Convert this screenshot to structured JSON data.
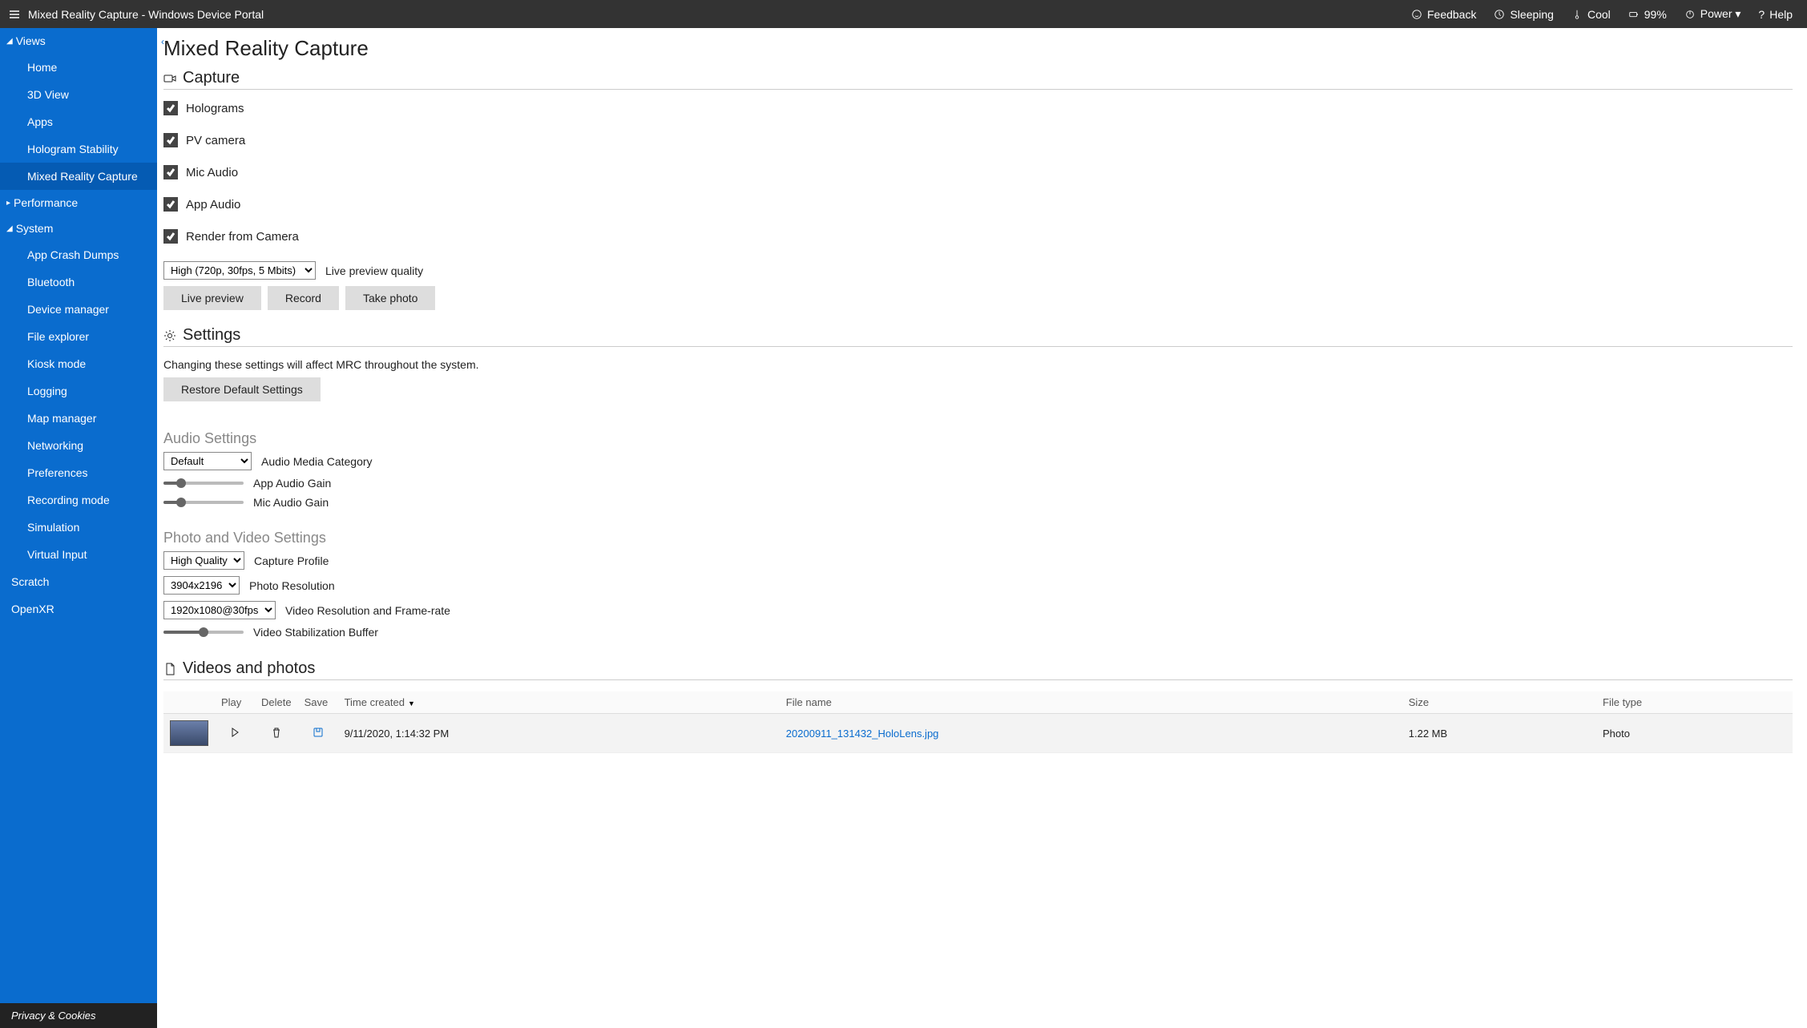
{
  "topbar": {
    "title": "Mixed Reality Capture - Windows Device Portal",
    "feedback": "Feedback",
    "sleeping": "Sleeping",
    "cool": "Cool",
    "battery": "99%",
    "power": "Power ▾",
    "help": "Help"
  },
  "sidebar": {
    "views": {
      "label": "Views",
      "items": [
        "Home",
        "3D View",
        "Apps",
        "Hologram Stability",
        "Mixed Reality Capture"
      ]
    },
    "performance": {
      "label": "Performance"
    },
    "system": {
      "label": "System",
      "items": [
        "App Crash Dumps",
        "Bluetooth",
        "Device manager",
        "File explorer",
        "Kiosk mode",
        "Logging",
        "Map manager",
        "Networking",
        "Preferences",
        "Recording mode",
        "Simulation",
        "Virtual Input"
      ]
    },
    "scratch": "Scratch",
    "openxr": "OpenXR",
    "privacy": "Privacy & Cookies"
  },
  "page": {
    "title": "Mixed Reality Capture",
    "capture": {
      "heading": "Capture",
      "checks": {
        "holograms": "Holograms",
        "pvcamera": "PV camera",
        "mic": "Mic Audio",
        "app": "App Audio",
        "render": "Render from Camera"
      },
      "quality_select": "High (720p, 30fps, 5 Mbits)",
      "quality_label": "Live preview quality",
      "live_preview": "Live preview",
      "record": "Record",
      "take_photo": "Take photo"
    },
    "settings": {
      "heading": "Settings",
      "hint": "Changing these settings will affect MRC throughout the system.",
      "restore": "Restore Default Settings",
      "audio": {
        "heading": "Audio Settings",
        "category_select": "Default",
        "category_label": "Audio Media Category",
        "app_gain": "App Audio Gain",
        "mic_gain": "Mic Audio Gain"
      },
      "photo_video": {
        "heading": "Photo and Video Settings",
        "profile_select": "High Quality",
        "profile_label": "Capture Profile",
        "photo_res_select": "3904x2196",
        "photo_res_label": "Photo Resolution",
        "video_res_select": "1920x1080@30fps",
        "video_res_label": "Video Resolution and Frame-rate",
        "stab_label": "Video Stabilization Buffer"
      }
    },
    "media": {
      "heading": "Videos and photos",
      "columns": {
        "play": "Play",
        "delete": "Delete",
        "save": "Save",
        "time": "Time created",
        "file": "File name",
        "size": "Size",
        "type": "File type"
      },
      "rows": [
        {
          "time": "9/11/2020, 1:14:32 PM",
          "file": "20200911_131432_HoloLens.jpg",
          "size": "1.22 MB",
          "type": "Photo"
        }
      ]
    }
  }
}
